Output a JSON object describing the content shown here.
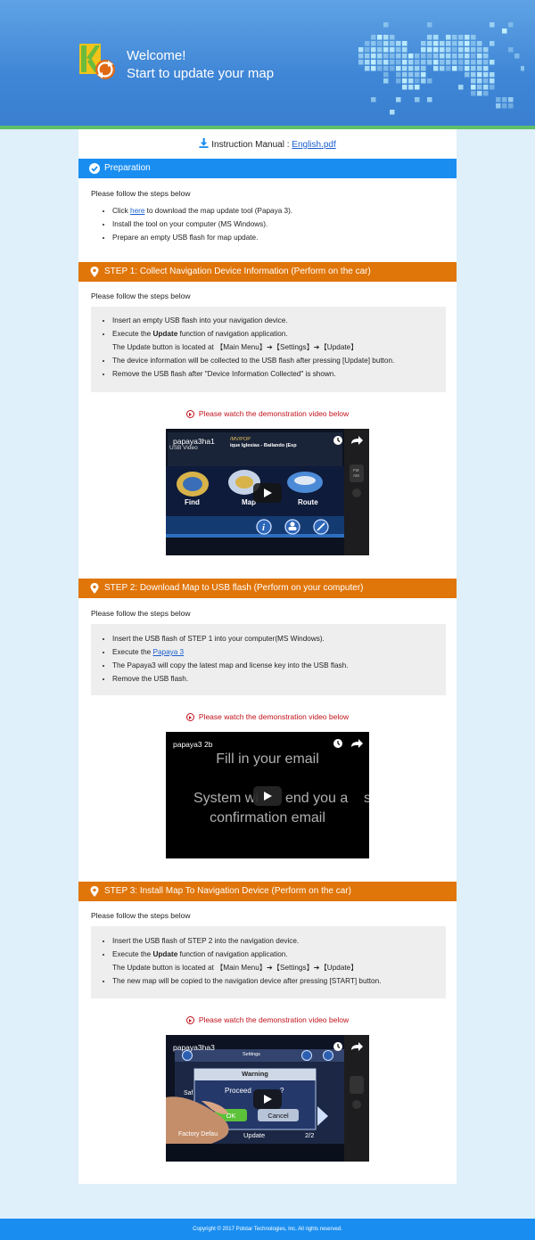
{
  "header": {
    "welcome": "Welcome!",
    "subtitle": "Start to update your map"
  },
  "manual": {
    "prefix": "Instruction Manual : ",
    "link": "English.pdf"
  },
  "preparation": {
    "title": "Preparation",
    "intro": "Please follow the steps below",
    "items": [
      {
        "before": "Click ",
        "link": "here",
        "after": " to download the map update tool (Papaya 3)."
      },
      {
        "text": "Install the tool on your computer (MS Windows)."
      },
      {
        "text": "Prepare an empty USB flash for map update."
      }
    ]
  },
  "step1": {
    "title": "STEP 1: Collect Navigation Device Information (Perform on the car)",
    "intro": "Please follow the steps below",
    "items": {
      "i0": "Insert an empty USB flash into your navigation device.",
      "i1_pre": "Execute the ",
      "i1_bold": "Update",
      "i1_post": " function of navigation application.",
      "i1_sub": "The Update button is located at  【Main Menu】➔【Settings】➔【Update】",
      "i2": "The device information will be collected to the USB flash after pressing [Update] button.",
      "i3": "Remove the USB flash after \"Device Information Collected\" is shown."
    },
    "watch": "Please watch the demonstration video below",
    "video": {
      "title": "papaya3ha1",
      "usb": "USB Video",
      "path": "/MV/POP",
      "song": "ique Iglesias - Bailando (Esp",
      "find": "Find",
      "map": "Map",
      "route": "Route",
      "fm": "FM",
      "am": "AM"
    }
  },
  "step2": {
    "title": "STEP 2: Download Map to USB flash (Perform on your computer)",
    "intro": "Please follow the steps below",
    "items": {
      "i0": "Insert the USB flash of STEP 1 into your computer(MS Windows).",
      "i1_pre": "Execute the ",
      "i1_link": "Papaya 3",
      "i2": "The Papaya3 will copy the latest map and license key into the USB flash.",
      "i3": "Remove the USB flash."
    },
    "watch": "Please watch the demonstration video below",
    "video": {
      "title": "papaya3 2b",
      "line1": "Fill in your email",
      "line2a": "System wi",
      "line2b": "end you a",
      "line3": "confirmation email",
      "edge": "s"
    }
  },
  "step3": {
    "title": "STEP 3: Install Map To Navigation Device (Perform on the car)",
    "intro": "Please follow the steps below",
    "items": {
      "i0": "Insert the USB flash of STEP 2 into the navigation device.",
      "i1_pre": "Execute the ",
      "i1_bold": "Update",
      "i1_post": " function of navigation application.",
      "i1_sub": "The Update button is located at  【Main Menu】➔【Settings】➔【Update】",
      "i2": "The new map will be copied to the navigation device after pressing [START] button."
    },
    "watch": "Please watch the demonstration video below",
    "video": {
      "title": "papaya3ha3",
      "settings": "Settings",
      "warning": "Warning",
      "proceed": "Proceed",
      "proceed_end": "?",
      "ok": "OK",
      "cancel": "Cancel",
      "factory": "Factory Defau",
      "update": "Update",
      "page": "2/2",
      "saf": "Saf"
    }
  },
  "footer": {
    "text": "Copyright © 2017 Polstar Technologies, Inc. All rights reserved."
  },
  "colors": {
    "blue": "#1a8ef0",
    "orange": "#e07509",
    "red": "#c0121b",
    "green": "#5cc06a"
  }
}
